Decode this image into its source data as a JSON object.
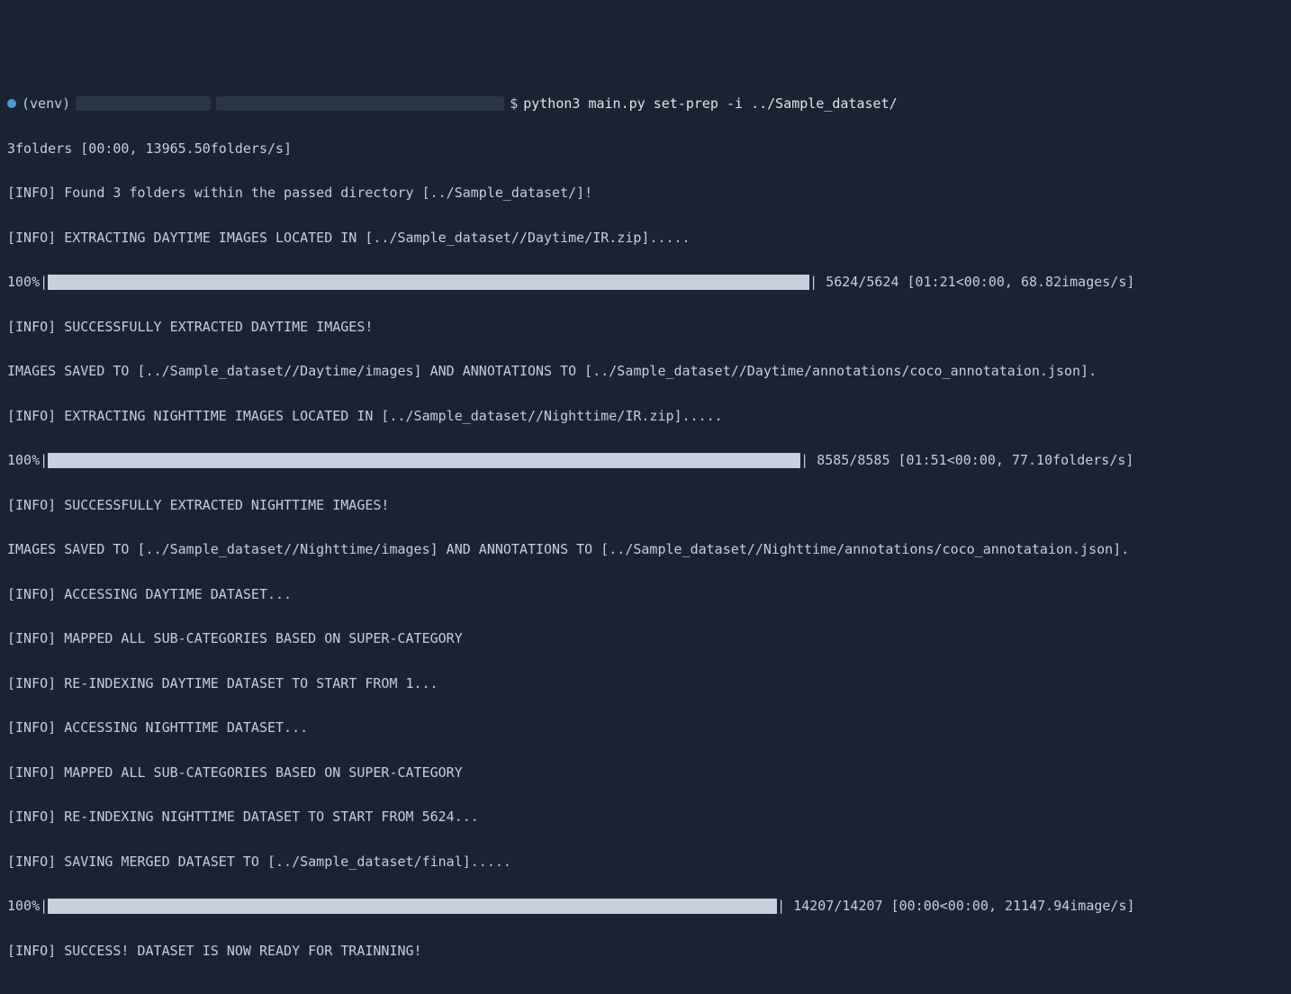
{
  "prompt": {
    "venv_label": "(venv)",
    "dollar": "$",
    "command": "python3 main.py set-prep -i ../Sample_dataset/"
  },
  "lines": {
    "l1": "3folders [00:00, 13965.50folders/s]",
    "l2": "[INFO] Found 3 folders within the passed directory [../Sample_dataset/]!",
    "l3": "[INFO] EXTRACTING DAYTIME IMAGES LOCATED IN [../Sample_dataset//Daytime/IR.zip].....",
    "p1_label": "100%|",
    "p1_stats": "| 5624/5624 [01:21<00:00, 68.82images/s]",
    "l5": "[INFO] SUCCESSFULLY EXTRACTED DAYTIME IMAGES!",
    "l6": "IMAGES SAVED TO [../Sample_dataset//Daytime/images] AND ANNOTATIONS TO [../Sample_dataset//Daytime/annotations/coco_annotataion.json].",
    "l7": "[INFO] EXTRACTING NIGHTTIME IMAGES LOCATED IN [../Sample_dataset//Nighttime/IR.zip].....",
    "p2_label": "100%|",
    "p2_stats": "| 8585/8585 [01:51<00:00, 77.10folders/s]",
    "l9": "[INFO] SUCCESSFULLY EXTRACTED NIGHTTIME IMAGES!",
    "l10": "IMAGES SAVED TO [../Sample_dataset//Nighttime/images] AND ANNOTATIONS TO [../Sample_dataset//Nighttime/annotations/coco_annotataion.json].",
    "l11": "[INFO] ACCESSING DAYTIME DATASET...",
    "l12": "[INFO] MAPPED ALL SUB-CATEGORIES BASED ON SUPER-CATEGORY",
    "l13": "[INFO] RE-INDEXING DAYTIME DATASET TO START FROM 1...",
    "l14": "[INFO] ACCESSING NIGHTTIME DATASET...",
    "l15": "[INFO] MAPPED ALL SUB-CATEGORIES BASED ON SUPER-CATEGORY",
    "l16": "[INFO] RE-INDEXING NIGHTTIME DATASET TO START FROM 5624...",
    "l17": "[INFO] SAVING MERGED DATASET TO [../Sample_dataset/final].....",
    "p3_label": "100%|",
    "p3_stats": "| 14207/14207 [00:00<00:00, 21147.94image/s]",
    "l19": "[INFO] SUCCESS! DATASET IS NOW READY FOR TRAINNING!"
  },
  "progress_bar_widths": {
    "p1": 846,
    "p2": 836,
    "p3": 810
  }
}
